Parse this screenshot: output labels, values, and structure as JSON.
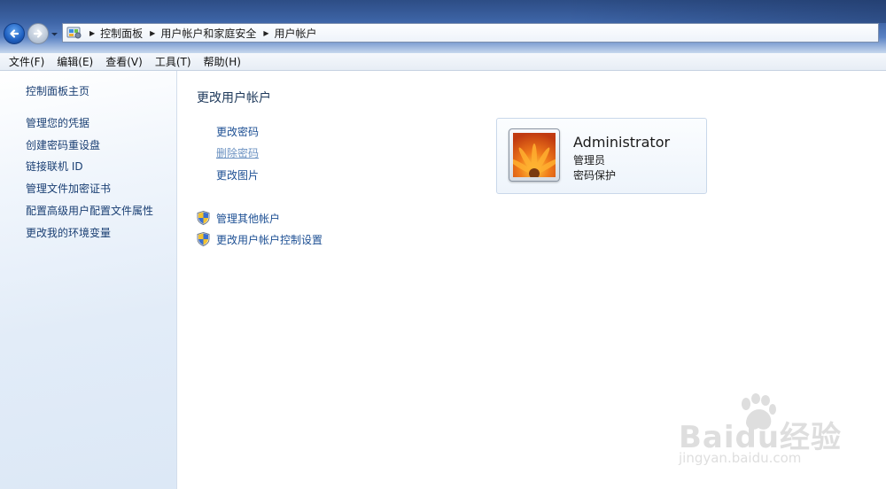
{
  "window": {
    "breadcrumbs": [
      "控制面板",
      "用户帐户和家庭安全",
      "用户帐户"
    ]
  },
  "menu": [
    "文件(F)",
    "编辑(E)",
    "查看(V)",
    "工具(T)",
    "帮助(H)"
  ],
  "sidebar": {
    "home": "控制面板主页",
    "items": [
      "管理您的凭据",
      "创建密码重设盘",
      "链接联机 ID",
      "管理文件加密证书",
      "配置高级用户配置文件属性",
      "更改我的环境变量"
    ]
  },
  "main": {
    "title": "更改用户帐户",
    "tasks": [
      "更改密码",
      "删除密码",
      "更改图片"
    ],
    "admin_tasks": [
      "管理其他帐户",
      "更改用户帐户控制设置"
    ]
  },
  "account": {
    "name": "Administrator",
    "role": "管理员",
    "status": "密码保护"
  },
  "watermark": {
    "brand": "Baidu经验",
    "url": "jingyan.baidu.com"
  },
  "colors": {
    "link": "#1c4f93",
    "visited_link": "#6d93c2",
    "title": "#1e395b",
    "titlebar": "#3d64a6"
  },
  "icons": {
    "back": "back-arrow-icon",
    "forward": "forward-arrow-icon",
    "address": "control-panel-icon",
    "uac": "uac-shield-icon",
    "avatar": "flower-avatar-icon"
  }
}
